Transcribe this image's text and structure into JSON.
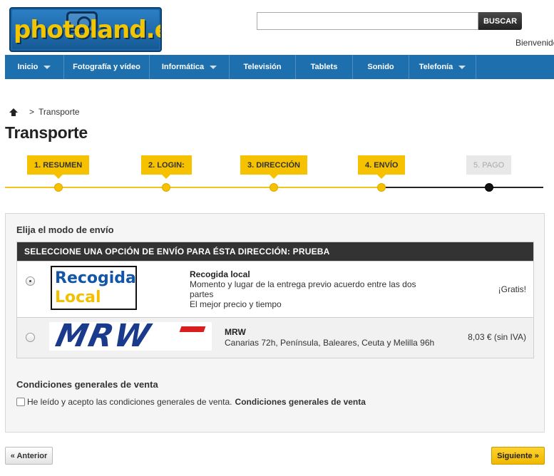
{
  "header": {
    "logo_text": "photoland.es",
    "search_placeholder": "",
    "search_button": "BUSCAR",
    "welcome": "Bienvenido"
  },
  "nav": {
    "items": [
      {
        "label": "Inicio",
        "has_dropdown": true
      },
      {
        "label": "Fotografía y vídeo",
        "has_dropdown": false
      },
      {
        "label": "Informática",
        "has_dropdown": true
      },
      {
        "label": "Televisión",
        "has_dropdown": false
      },
      {
        "label": "Tablets",
        "has_dropdown": false
      },
      {
        "label": "Sonido",
        "has_dropdown": false
      },
      {
        "label": "Telefonía",
        "has_dropdown": true
      }
    ]
  },
  "breadcrumb": {
    "separator": ">",
    "current": "Transporte"
  },
  "page_title": "Transporte",
  "steps": [
    {
      "label": "1. RESUMEN",
      "status": "done"
    },
    {
      "label": "2. LOGIN:",
      "status": "done"
    },
    {
      "label": "3. DIRECCIÓN",
      "status": "done"
    },
    {
      "label": "4. ENVÍO",
      "status": "current"
    },
    {
      "label": "5. PAGO",
      "status": "pending"
    }
  ],
  "shipping": {
    "title": "Elija el modo de envío",
    "table_header": "SELECCIONE UNA OPCIÓN DE ENVÍO PARA ÉSTA DIRECCIÓN: PRUEBA",
    "options": [
      {
        "logo_line1": "Recogida",
        "logo_line2": "Local",
        "name": "Recogida local",
        "desc_line1": "Momento y lugar de la entrega previo acuerdo entre las dos",
        "desc_line2": "partes",
        "desc_line3": "El mejor precio y tiempo",
        "price": "¡Gratis!",
        "selected": true
      },
      {
        "logo_text": "MRW",
        "name": "MRW",
        "desc_line1": "Canarias 72h, Península, Baleares, Ceuta y Melilla 96h",
        "price": "8,03 € (sin IVA)",
        "selected": false
      }
    ]
  },
  "conditions": {
    "title": "Condiciones generales de venta",
    "checkbox_label": "He leído y acepto las condiciones generales de venta.",
    "link_label": "Condiciones generales de venta",
    "checked": false
  },
  "footer": {
    "prev_label": "« Anterior",
    "next_label": "Siguiente »"
  },
  "colors": {
    "nav_blue": "#1d6fad",
    "step_yellow": "#f6c200",
    "header_dark": "#333333"
  }
}
